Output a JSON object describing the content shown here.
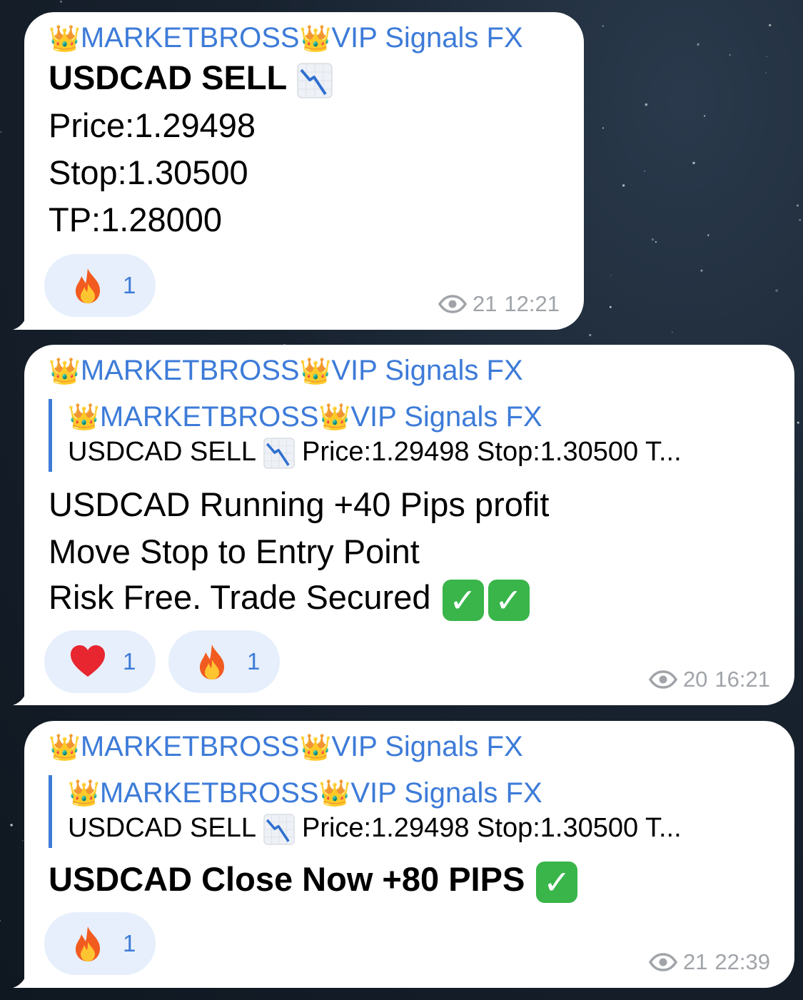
{
  "messages": [
    {
      "sender": {
        "before": "MARKETBROSS",
        "after": "VIP Signals FX"
      },
      "lines": [
        "USDCAD SELL",
        "Price:1.29498",
        "Stop:1.30500",
        "TP:1.28000"
      ],
      "reactions": [
        {
          "emoji": "fire-icon",
          "count": "1"
        }
      ],
      "views": "21",
      "time": "12:21"
    },
    {
      "sender": {
        "before": "MARKETBROSS",
        "after": "VIP Signals FX"
      },
      "reply": {
        "sender": {
          "before": "MARKETBROSS",
          "after": "VIP Signals FX"
        },
        "text_before": "USDCAD SELL",
        "text_after": "Price:1.29498 Stop:1.30500 T..."
      },
      "lines": [
        "USDCAD Running +40 Pips profit",
        "Move Stop to Entry Point",
        "Risk Free. Trade Secured"
      ],
      "reactions": [
        {
          "emoji": "heart-icon",
          "count": "1"
        },
        {
          "emoji": "fire-icon",
          "count": "1"
        }
      ],
      "views": "20",
      "time": "16:21"
    },
    {
      "sender": {
        "before": "MARKETBROSS",
        "after": "VIP Signals FX"
      },
      "reply": {
        "sender": {
          "before": "MARKETBROSS",
          "after": "VIP Signals FX"
        },
        "text_before": "USDCAD SELL",
        "text_after": "Price:1.29498 Stop:1.30500 T..."
      },
      "lines": [
        "USDCAD Close Now +80 PIPS"
      ],
      "reactions": [
        {
          "emoji": "fire-icon",
          "count": "1"
        }
      ],
      "views": "21",
      "time": "22:39"
    }
  ],
  "colors": {
    "accent": "#3d7bd8",
    "bubble": "#ffffff",
    "reaction_bg": "#e6effb",
    "meta": "#a0a4a9",
    "check": "#39b54a",
    "background": "#18222f"
  }
}
